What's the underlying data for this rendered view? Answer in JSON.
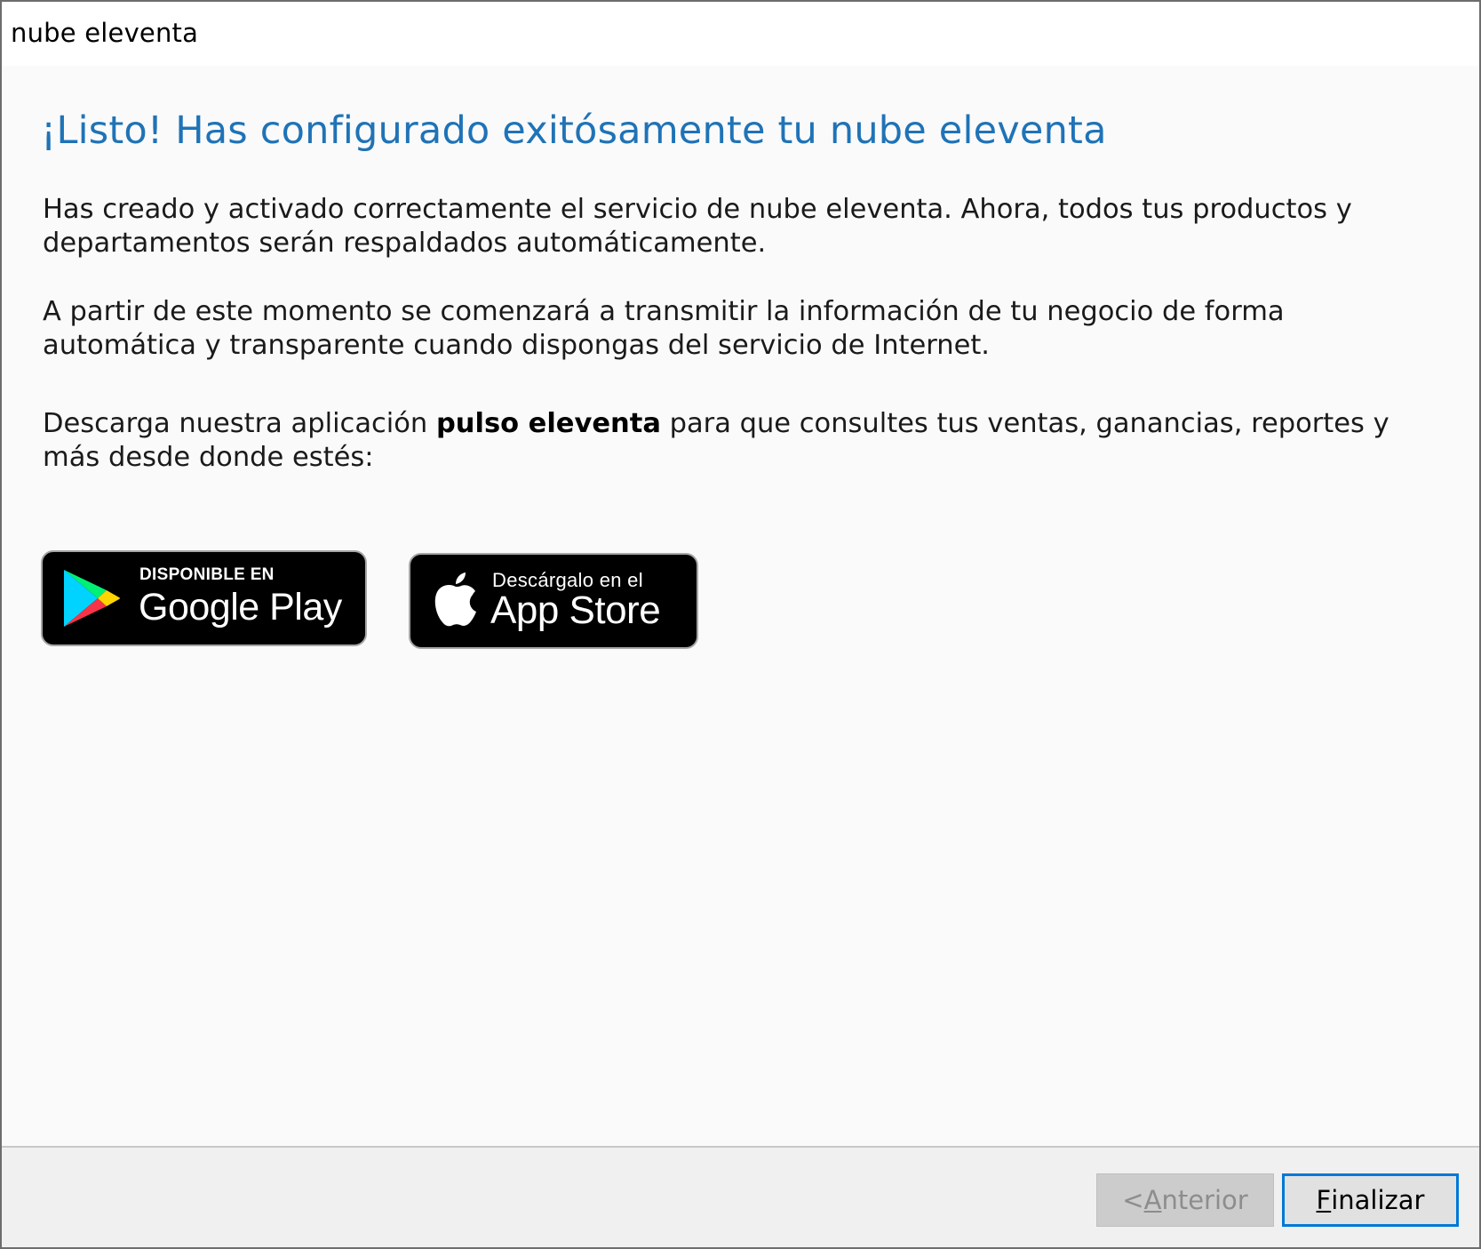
{
  "window": {
    "title": "nube eleventa"
  },
  "main": {
    "heading": "¡Listo! Has configurado exitósamente tu nube eleventa",
    "paragraph1": "Has creado y activado correctamente el servicio de nube eleventa. Ahora, todos tus productos y departamentos serán respaldados automáticamente.",
    "paragraph2": "A partir de este momento se comenzará a transmitir la información de tu negocio de forma automática y transparente cuando dispongas del servicio de Internet.",
    "paragraph3": {
      "before": "Descarga nuestra aplicación ",
      "app_name": "pulso eleventa",
      "after": " para que consultes tus ventas, ganancias, reportes y más desde donde estés:"
    }
  },
  "badges": {
    "google": {
      "small": "DISPONIBLE EN",
      "big": "Google Play",
      "icon": "google-play-icon"
    },
    "apple": {
      "small": "Descárgalo en el",
      "big": "App Store",
      "icon": "apple-icon"
    }
  },
  "footer": {
    "prev_label_prefix": "< ",
    "prev_label_mnemonic": "A",
    "prev_label_rest": "nterior",
    "prev_disabled": true,
    "finish_label_mnemonic": "F",
    "finish_label_rest": "inalizar"
  },
  "colors": {
    "heading": "#1f73b7",
    "focus_border": "#0078d7",
    "badge_background": "#000000"
  }
}
